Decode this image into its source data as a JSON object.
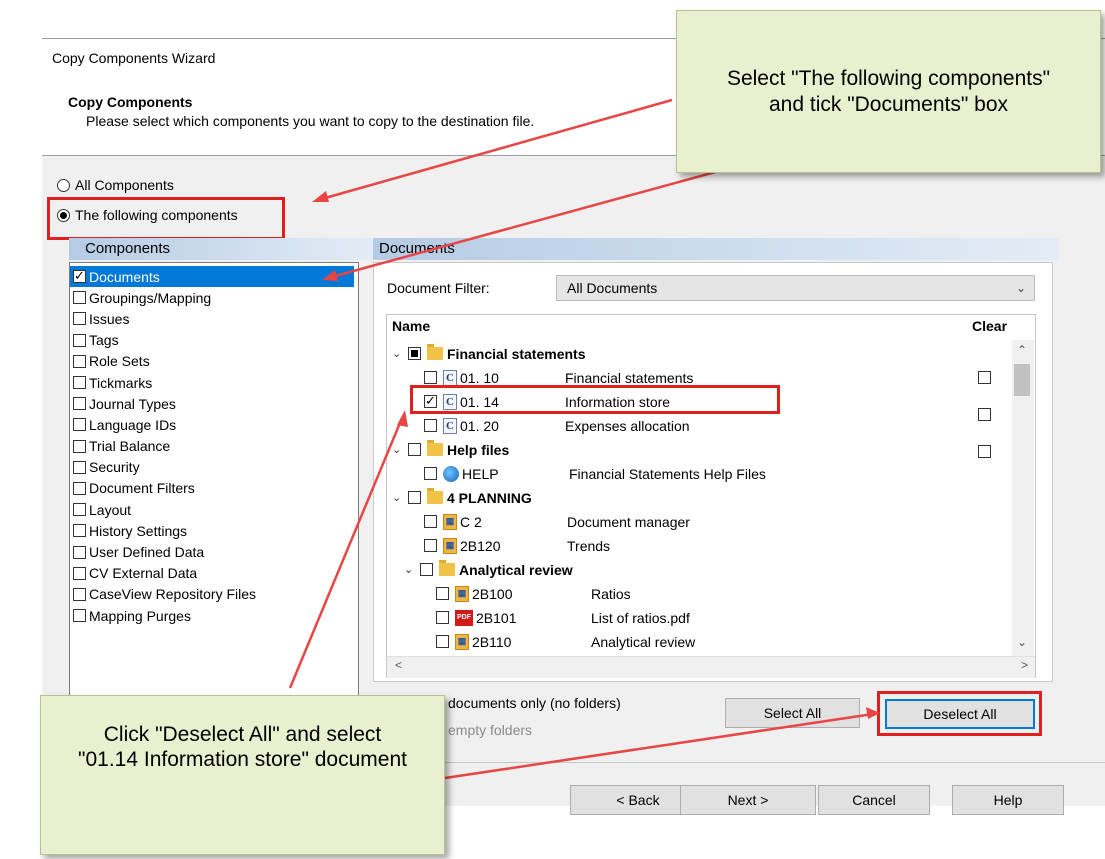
{
  "wizard": {
    "window_title": "Copy Components Wizard",
    "heading": "Copy Components",
    "subheading": "Please select which components you want to copy to the destination file."
  },
  "scope": {
    "option_all": "All Components",
    "option_following": "The following components",
    "selected": "The following components"
  },
  "components": {
    "header": "Components",
    "items": [
      {
        "label": "Documents",
        "checked": true,
        "selected": true
      },
      {
        "label": "Groupings/Mapping",
        "checked": false
      },
      {
        "label": "Issues",
        "checked": false
      },
      {
        "label": "Tags",
        "checked": false
      },
      {
        "label": "Role Sets",
        "checked": false
      },
      {
        "label": "Tickmarks",
        "checked": false
      },
      {
        "label": "Journal Types",
        "checked": false
      },
      {
        "label": "Language IDs",
        "checked": false
      },
      {
        "label": "Trial Balance",
        "checked": false
      },
      {
        "label": "Security",
        "checked": false
      },
      {
        "label": "Document Filters",
        "checked": false
      },
      {
        "label": "Layout",
        "checked": false
      },
      {
        "label": "History Settings",
        "checked": false
      },
      {
        "label": "User Defined Data",
        "checked": false
      },
      {
        "label": "CV External Data",
        "checked": false
      },
      {
        "label": "CaseView Repository Files",
        "checked": false
      },
      {
        "label": "Mapping Purges",
        "checked": false
      }
    ]
  },
  "documents": {
    "header": "Documents",
    "filter_label": "Document Filter:",
    "filter_value": "All Documents",
    "col_name": "Name",
    "col_clear": "Clear",
    "tree": {
      "folder_financial": "Financial statements",
      "doc_0110_id": "01. 10",
      "doc_0110_name": "Financial statements",
      "doc_0114_id": "01. 14",
      "doc_0114_name": "Information store",
      "doc_0120_id": "01. 20",
      "doc_0120_name": "Expenses allocation",
      "folder_help": "Help files",
      "doc_help_id": "HELP",
      "doc_help_name": "Financial Statements Help Files",
      "folder_planning": "4 PLANNING",
      "doc_c2_id": "C 2",
      "doc_c2_name": "Document manager",
      "doc_2b120_id": "2B120",
      "doc_2b120_name": "Trends",
      "folder_analytical": "Analytical review",
      "doc_2b100_id": "2B100",
      "doc_2b100_name": "Ratios",
      "doc_2b101_id": "2B101",
      "doc_2b101_name": "List of ratios.pdf",
      "doc_2b110_id": "2B110",
      "doc_2b110_name": "Analytical review",
      "pdf_badge": "PDF"
    },
    "option_docs_only": "documents only (no folders)",
    "option_empty": "empty folders",
    "select_all": "Select All",
    "deselect_all": "Deselect All"
  },
  "footer": {
    "back": "< Back",
    "next": "Next >",
    "cancel": "Cancel",
    "help": "Help"
  },
  "callouts": {
    "top": "Select \"The following components\" and tick \"Documents\" box",
    "bottom": "Click \"Deselect All\" and select \"01.14 Information store\" document"
  },
  "colors": {
    "accent": "#0078d7",
    "highlight_box": "#e02020",
    "callout_bg": "#e9f0cf"
  }
}
